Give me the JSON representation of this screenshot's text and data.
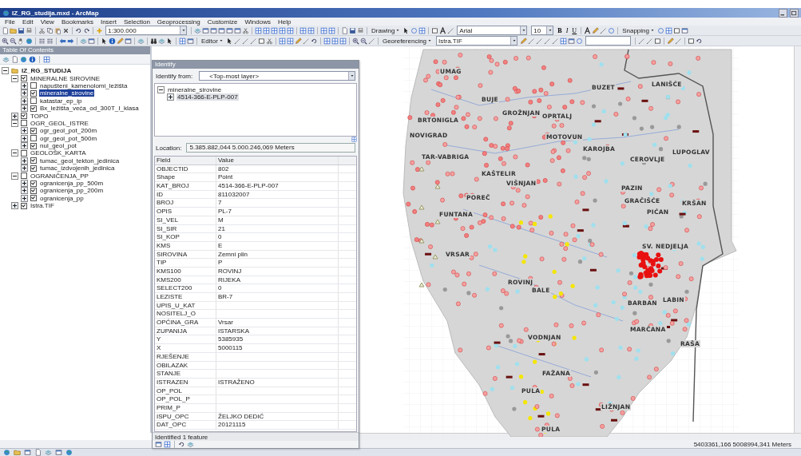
{
  "window": {
    "title": "IZ_RG_studija.mxd - ArcMap"
  },
  "menu": [
    "File",
    "Edit",
    "View",
    "Bookmarks",
    "Insert",
    "Selection",
    "Geoprocessing",
    "Customize",
    "Windows",
    "Help"
  ],
  "toolbar_1": {
    "scale": "1:300.000",
    "drawing_menu": "Drawing",
    "font": "Arial",
    "font_size": "10",
    "bold": "B",
    "italic": "I",
    "underline": "U",
    "snapping_menu": "Snapping"
  },
  "toolbar_2": {
    "editor_menu": "Editor",
    "georeferencing_menu": "Georeferencing",
    "layer": "Istra.TIF"
  },
  "toc": {
    "title": "Table Of Contents",
    "items": [
      {
        "label": "IZ_RG_STUDIJA",
        "kind": "frame",
        "expanded": true,
        "children": [
          {
            "label": "MINERALNE SIROVINE",
            "checked": true,
            "expanded": true,
            "selected": false,
            "children": [
              {
                "label": "napušteni_kamenolomi_ležišta",
                "checked": false,
                "expanded": false,
                "selected": false
              },
              {
                "label": "mineralne_sirovine",
                "checked": true,
                "expanded": false,
                "selected": true
              },
              {
                "label": "katastar_ep_ip",
                "checked": false,
                "expanded": false,
                "selected": false
              },
              {
                "label": "Bx_ležišta_veća_od_300T_I_klasa",
                "checked": true,
                "expanded": false,
                "selected": false
              }
            ]
          },
          {
            "label": "TOPO",
            "checked": true,
            "expanded": false,
            "selected": false
          },
          {
            "label": "OGR_GEOL_ISTRE",
            "checked": false,
            "expanded": true,
            "selected": false,
            "children": [
              {
                "label": "ogr_geol_pot_200m",
                "checked": true,
                "expanded": false,
                "selected": false
              },
              {
                "label": "ogr_geol_pot_500m",
                "checked": false,
                "expanded": false,
                "selected": false
              },
              {
                "label": "nul_geol_pot",
                "checked": true,
                "expanded": false,
                "selected": false
              }
            ]
          },
          {
            "label": "GEOLOŠK_KARTA",
            "checked": false,
            "expanded": true,
            "selected": false,
            "children": [
              {
                "label": "tumac_geol_tekton_jedinica",
                "checked": true,
                "expanded": false,
                "selected": false
              },
              {
                "label": "tumac_izdvojenih_jedinica",
                "checked": true,
                "expanded": false,
                "selected": false
              }
            ]
          },
          {
            "label": "OGRANIČENJA_PP",
            "checked": false,
            "expanded": true,
            "selected": false,
            "children": [
              {
                "label": "ogranicenja_pp_500m",
                "checked": true,
                "expanded": false,
                "selected": false
              },
              {
                "label": "ogranicenja_pp_200m",
                "checked": true,
                "expanded": false,
                "selected": false
              },
              {
                "label": "ogranicenja_pp",
                "checked": true,
                "expanded": false,
                "selected": false
              }
            ]
          },
          {
            "label": "Istra.TIF",
            "checked": true,
            "expanded": false,
            "selected": false
          }
        ]
      }
    ]
  },
  "identify": {
    "title": "Identify",
    "from_label": "Identify from:",
    "from_value": "<Top-most layer>",
    "tree": [
      {
        "label": "mineralne_sirovine",
        "expanded": true,
        "selected": false,
        "children": [
          {
            "label": "4514-366-E-PLP-007",
            "expanded": false,
            "selected": true
          }
        ]
      }
    ],
    "location_label": "Location:",
    "location": "5.385.882,044  5.000.246,069 Meters",
    "columns": [
      "Field",
      "Value"
    ],
    "rows": [
      {
        "field": "OBJECTID",
        "value": "802"
      },
      {
        "field": "Shape",
        "value": "Point"
      },
      {
        "field": "KAT_BROJ",
        "value": "4514-366-E-PLP-007"
      },
      {
        "field": "ID",
        "value": "811032007"
      },
      {
        "field": "BROJ",
        "value": "7"
      },
      {
        "field": "OPIS",
        "value": "PL-7"
      },
      {
        "field": "SI_VEL",
        "value": "M"
      },
      {
        "field": "SI_SIR",
        "value": "21"
      },
      {
        "field": "SI_KOP",
        "value": "0"
      },
      {
        "field": "KMS",
        "value": "E"
      },
      {
        "field": "SIROVINA",
        "value": "Zemni plin"
      },
      {
        "field": "TIP",
        "value": "P"
      },
      {
        "field": "KMS100",
        "value": "ROVINJ"
      },
      {
        "field": "KMS200",
        "value": "RIJEKA"
      },
      {
        "field": "SELECT200",
        "value": "0"
      },
      {
        "field": "LEZISTE",
        "value": "BR-7"
      },
      {
        "field": "UPIS_U_KAT"
      },
      {
        "field": "NOSITELJ_O"
      },
      {
        "field": "OPĆINA_GRA",
        "value": "Vrsar"
      },
      {
        "field": "ZUPANIJA",
        "value": "ISTARSKA"
      },
      {
        "field": "Y",
        "value": "5385935"
      },
      {
        "field": "X",
        "value": "5000115"
      },
      {
        "field": "RJEŠENJE"
      },
      {
        "field": "OBILAZAK"
      },
      {
        "field": "STANJE"
      },
      {
        "field": "ISTRAZEN",
        "value": "ISTRAŽENO"
      },
      {
        "field": "OP_POL"
      },
      {
        "field": "OP_POL_P"
      },
      {
        "field": "PRIM_P"
      },
      {
        "field": "ISPU_OPC",
        "value": "ŽELJKO DEDIĆ"
      },
      {
        "field": "DAT_OPC",
        "value": "20121115"
      }
    ],
    "status": "Identified 1 feature"
  },
  "map": {
    "towns": [
      "UMAG",
      "BUZET",
      "LANIŠĆE",
      "BUJE",
      "GROŽNJAN",
      "OPRTALJ",
      "BRTONIGLA",
      "NOVIGRAD",
      "MOTOVUN",
      "KAROJBA",
      "LUPOGLAV",
      "TAR-VABRIGA",
      "CEROVLJE",
      "KAŠTELIR",
      "VIŠNJAN",
      "PAZIN",
      "POREČ",
      "GRAČIŠĆE",
      "KRŠAN",
      "PIĆAN",
      "FUNTANA",
      "SV. NEDJELJA",
      "VRSAR",
      "ROVINJ",
      "BALE",
      "BARBAN",
      "LABIN",
      "MARČANA",
      "VODNJAN",
      "RAŠA",
      "FAŽANA",
      "PULA",
      "LIŽNJAN",
      "PULA"
    ]
  },
  "status_bar": {
    "coordinates": "5403361,166  5008994,341 Meters"
  }
}
